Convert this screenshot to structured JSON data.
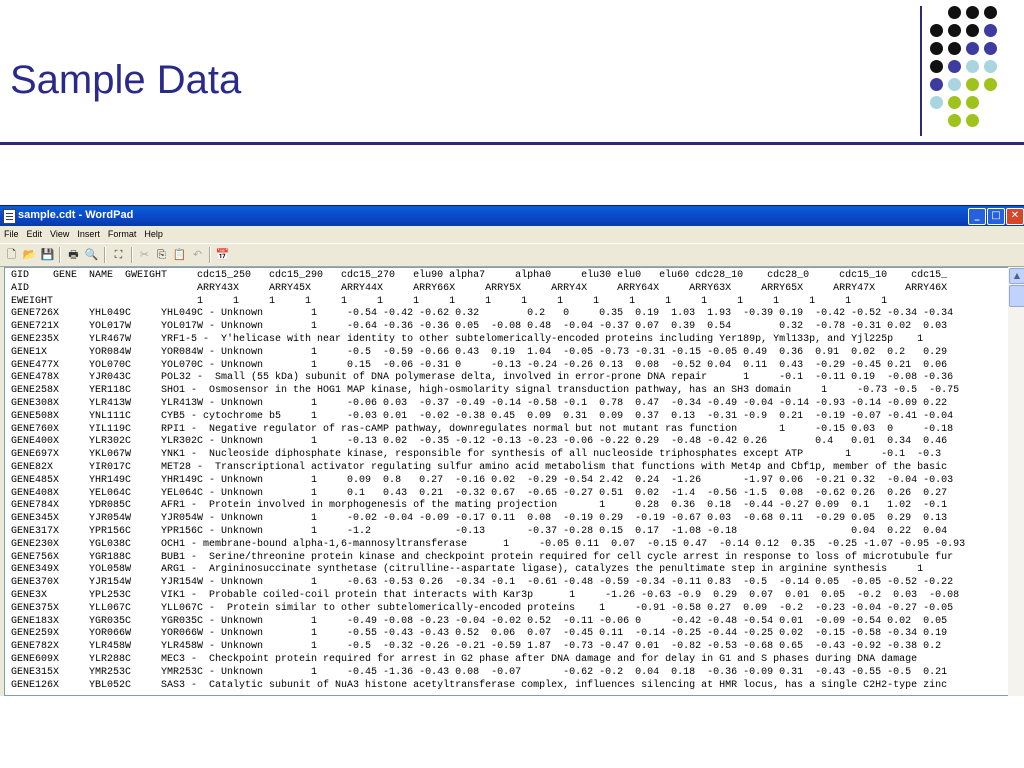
{
  "slide": {
    "title": "Sample Data",
    "colors": {
      "accent": "#2b2a7a",
      "dark": "#111111",
      "purple": "#3b3ba0",
      "light_blue": "#a8d5de",
      "green": "#9fc31c"
    }
  },
  "window": {
    "title": "sample.cdt - WordPad",
    "buttons": {
      "minimize": "_",
      "maximize": "□",
      "close": "✕"
    },
    "menu": [
      "File",
      "Edit",
      "View",
      "Insert",
      "Format",
      "Help"
    ],
    "toolbar_icons": [
      "new-icon",
      "open-icon",
      "save-icon",
      "print-icon",
      "print-preview-icon",
      "find-icon",
      "cut-icon",
      "copy-icon",
      "paste-icon",
      "undo-icon",
      "date-time-icon"
    ]
  },
  "document": {
    "lines": [
      "GID    GENE  NAME  GWEIGHT     cdc15_250   cdc15_290   cdc15_270   elu90 alpha7     alpha0     elu30 elu0   elu60 cdc28_10    cdc28_0     cdc15_10    cdc15_",
      "AID                            ARRY43X     ARRY45X     ARRY44X     ARRY66X     ARRY5X     ARRY4X     ARRY64X     ARRY63X     ARRY65X     ARRY47X     ARRY46X",
      "EWEIGHT                        1     1     1     1     1     1     1     1     1     1     1     1     1     1     1     1     1     1     1     1",
      "GENE726X     YHL049C     YHL049C - Unknown        1     -0.54 -0.42 -0.62 0.32        0.2   0     0.35  0.19  1.03  1.93  -0.39 0.19  -0.42 -0.52 -0.34 -0.34",
      "GENE721X     YOL017W     YOL017W - Unknown        1     -0.64 -0.36 -0.36 0.05  -0.08 0.48  -0.04 -0.37 0.07  0.39  0.54        0.32  -0.78 -0.31 0.02  0.03",
      "GENE235X     YLR467W     YRF1-5 -  Y'helicase with near identity to other subtelomerically-encoded proteins including Yer189p, Yml133p, and Yjl225p    1",
      "GENE1X       YOR084W     YOR084W - Unknown        1     -0.5  -0.59 -0.66 0.43  0.19  1.04  -0.05 -0.73 -0.31 -0.15 -0.05 0.49  0.36  0.91  0.02  0.2   0.29",
      "GENE477X     YOL070C     YOL070C - Unknown        1     0.15  -0.06 -0.31 0     -0.13 -0.24 -0.26 0.13  0.08  -0.52 0.04  0.11  0.43  -0.29 -0.45 0.21  0.06",
      "GENE478X     YJR043C     POL32 -  Small (55 kDa) subunit of DNA polymerase delta, involved in error-prone DNA repair      1     -0.1  -0.11 0.19  -0.08 -0.36",
      "GENE258X     YER118C     SHO1 -  Osmosensor in the HOG1 MAP kinase, high-osmolarity signal transduction pathway, has an SH3 domain     1     -0.73 -0.5  -0.75",
      "GENE308X     YLR413W     YLR413W - Unknown        1     -0.06 0.03  -0.37 -0.49 -0.14 -0.58 -0.1  0.78  0.47  -0.34 -0.49 -0.04 -0.14 -0.93 -0.14 -0.09 0.22",
      "GENE508X     YNL111C     CYB5 - cytochrome b5     1     -0.03 0.01  -0.02 -0.38 0.45  0.09  0.31  0.09  0.37  0.13  -0.31 -0.9  0.21  -0.19 -0.07 -0.41 -0.04",
      "GENE760X     YIL119C     RPI1 -  Negative regulator of ras-cAMP pathway, downregulates normal but not mutant ras function       1     -0.15 0.03  0     -0.18",
      "GENE400X     YLR302C     YLR302C - Unknown        1     -0.13 0.02  -0.35 -0.12 -0.13 -0.23 -0.06 -0.22 0.29  -0.48 -0.42 0.26        0.4   0.01  0.34  0.46",
      "GENE697X     YKL067W     YNK1 -  Nucleoside diphosphate kinase, responsible for synthesis of all nucleoside triphosphates except ATP       1     -0.1  -0.3",
      "GENE82X      YIR017C     MET28 -  Transcriptional activator regulating sulfur amino acid metabolism that functions with Met4p and Cbf1p, member of the basic",
      "GENE485X     YHR149C     YHR149C - Unknown        1     0.09  0.8   0.27  -0.16 0.02  -0.29 -0.54 2.42  0.24  -1.26       -1.97 0.06  -0.21 0.32  -0.04 -0.03",
      "GENE408X     YEL064C     YEL064C - Unknown        1     0.1   0.43  0.21  -0.32 0.67  -0.65 -0.27 0.51  0.02  -1.4  -0.56 -1.5  0.08  -0.62 0.26  0.26  0.27",
      "GENE784X     YDR085C     AFR1 -  Protein involved in morphogenesis of the mating projection       1     0.28  0.36  0.18  -0.44 -0.27 0.09  0.1   1.02  -0.1",
      "GENE345X     YJR054W     YJR054W - Unknown        1     -0.02 -0.04 -0.09 -0.17 0.11  0.08  -0.19 0.29  -0.19 -0.67 0.03  -0.68 0.11  -0.29 0.05  0.29  0.13",
      "GENE317X     YPR156C     YPR156C - Unknown        1     -1.2              -0.13       -0.37 -0.28 0.15  0.17  -1.08 -0.18                   0.04  0.22  0.04",
      "GENE230X     YGL038C     OCH1 - membrane-bound alpha-1,6-mannosyltransferase      1     -0.05 0.11  0.07  -0.15 0.47  -0.14 0.12  0.35  -0.25 -1.07 -0.95 -0.93",
      "GENE756X     YGR188C     BUB1 -  Serine/threonine protein kinase and checkpoint protein required for cell cycle arrest in response to loss of microtubule fur",
      "GENE349X     YOL058W     ARG1 -  Argininosuccinate synthetase (citrulline--aspartate ligase), catalyzes the penultimate step in arginine synthesis     1",
      "GENE370X     YJR154W     YJR154W - Unknown        1     -0.63 -0.53 0.26  -0.34 -0.1  -0.61 -0.48 -0.59 -0.34 -0.11 0.83  -0.5  -0.14 0.05  -0.05 -0.52 -0.22",
      "GENE3X       YPL253C     VIK1 -  Probable coiled-coil protein that interacts with Kar3p      1     -1.26 -0.63 -0.9  0.29  0.07  0.01  0.05  -0.2  0.03  -0.08",
      "GENE375X     YLL067C     YLL067C -  Protein similar to other subtelomerically-encoded proteins    1     -0.91 -0.58 0.27  0.09  -0.2  -0.23 -0.04 -0.27 -0.05",
      "GENE183X     YGR035C     YGR035C - Unknown        1     -0.49 -0.08 -0.23 -0.04 -0.02 0.52  -0.11 -0.06 0     -0.42 -0.48 -0.54 0.01  -0.09 -0.54 0.02  0.05",
      "GENE259X     YOR066W     YOR066W - Unknown        1     -0.55 -0.43 -0.43 0.52  0.06  0.07  -0.45 0.11  -0.14 -0.25 -0.44 -0.25 0.02  -0.15 -0.58 -0.34 0.19",
      "GENE782X     YLR458W     YLR458W - Unknown        1     -0.5  -0.32 -0.26 -0.21 -0.59 1.87  -0.73 -0.47 0.01  -0.82 -0.53 -0.68 0.65  -0.43 -0.92 -0.38 0.2",
      "GENE609X     YLR288C     MEC3 -  Checkpoint protein required for arrest in G2 phase after DNA damage and for delay in G1 and S phases during DNA damage",
      "GENE315X     YMR253C     YMR253C - Unknown        1     -0.45 -1.36 -0.43 0.08  -0.07       -0.62 -0.2  0.04  0.18  -0.36 -0.09 0.31  -0.43 -0.55 -0.5  0.21",
      "GENE126X     YBL052C     SAS3 -  Catalytic subunit of NuA3 histone acetyltransferase complex, influences silencing at HMR locus, has a single C2H2-type zinc"
    ]
  }
}
